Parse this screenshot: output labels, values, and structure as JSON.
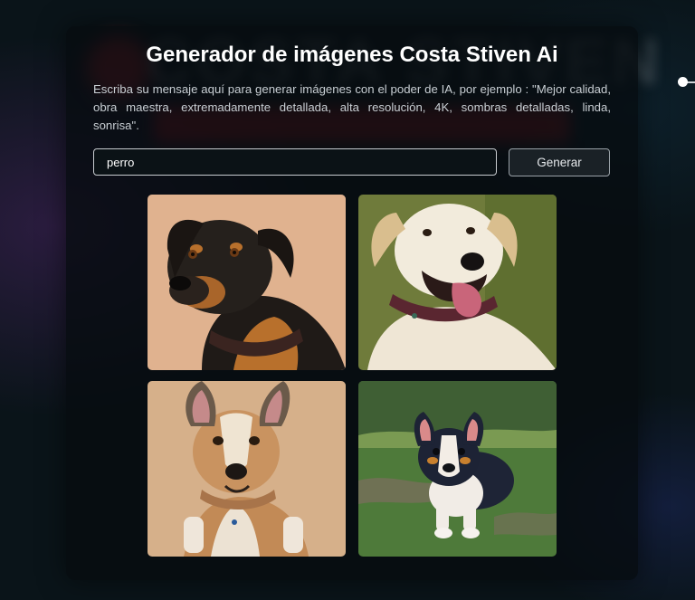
{
  "app": {
    "title": "Generador de imágenes Costa Stiven Ai",
    "description": "Escriba su mensaje aquí para generar imágenes con el poder de IA, por ejemplo : \"Mejor calidad, obra maestra, extremadamente detallada, alta resolución, 4K, sombras detalladas, linda, sonrisa\"."
  },
  "prompt": {
    "value": "perro",
    "placeholder": ""
  },
  "generate_button": {
    "label": "Generar"
  },
  "results": {
    "images": [
      {
        "icon": "dog-rottweiler-image",
        "background": "#e6b896"
      },
      {
        "icon": "dog-labrador-image",
        "background": "#6e7a3a"
      },
      {
        "icon": "dog-shepherd-mix-image",
        "background": "#d9b38e"
      },
      {
        "icon": "dog-corgi-image",
        "background": "#4f7a38"
      }
    ]
  },
  "colors": {
    "card_background": "#060c10",
    "button_background": "#1a2126",
    "input_border": "#c8ccd0"
  }
}
